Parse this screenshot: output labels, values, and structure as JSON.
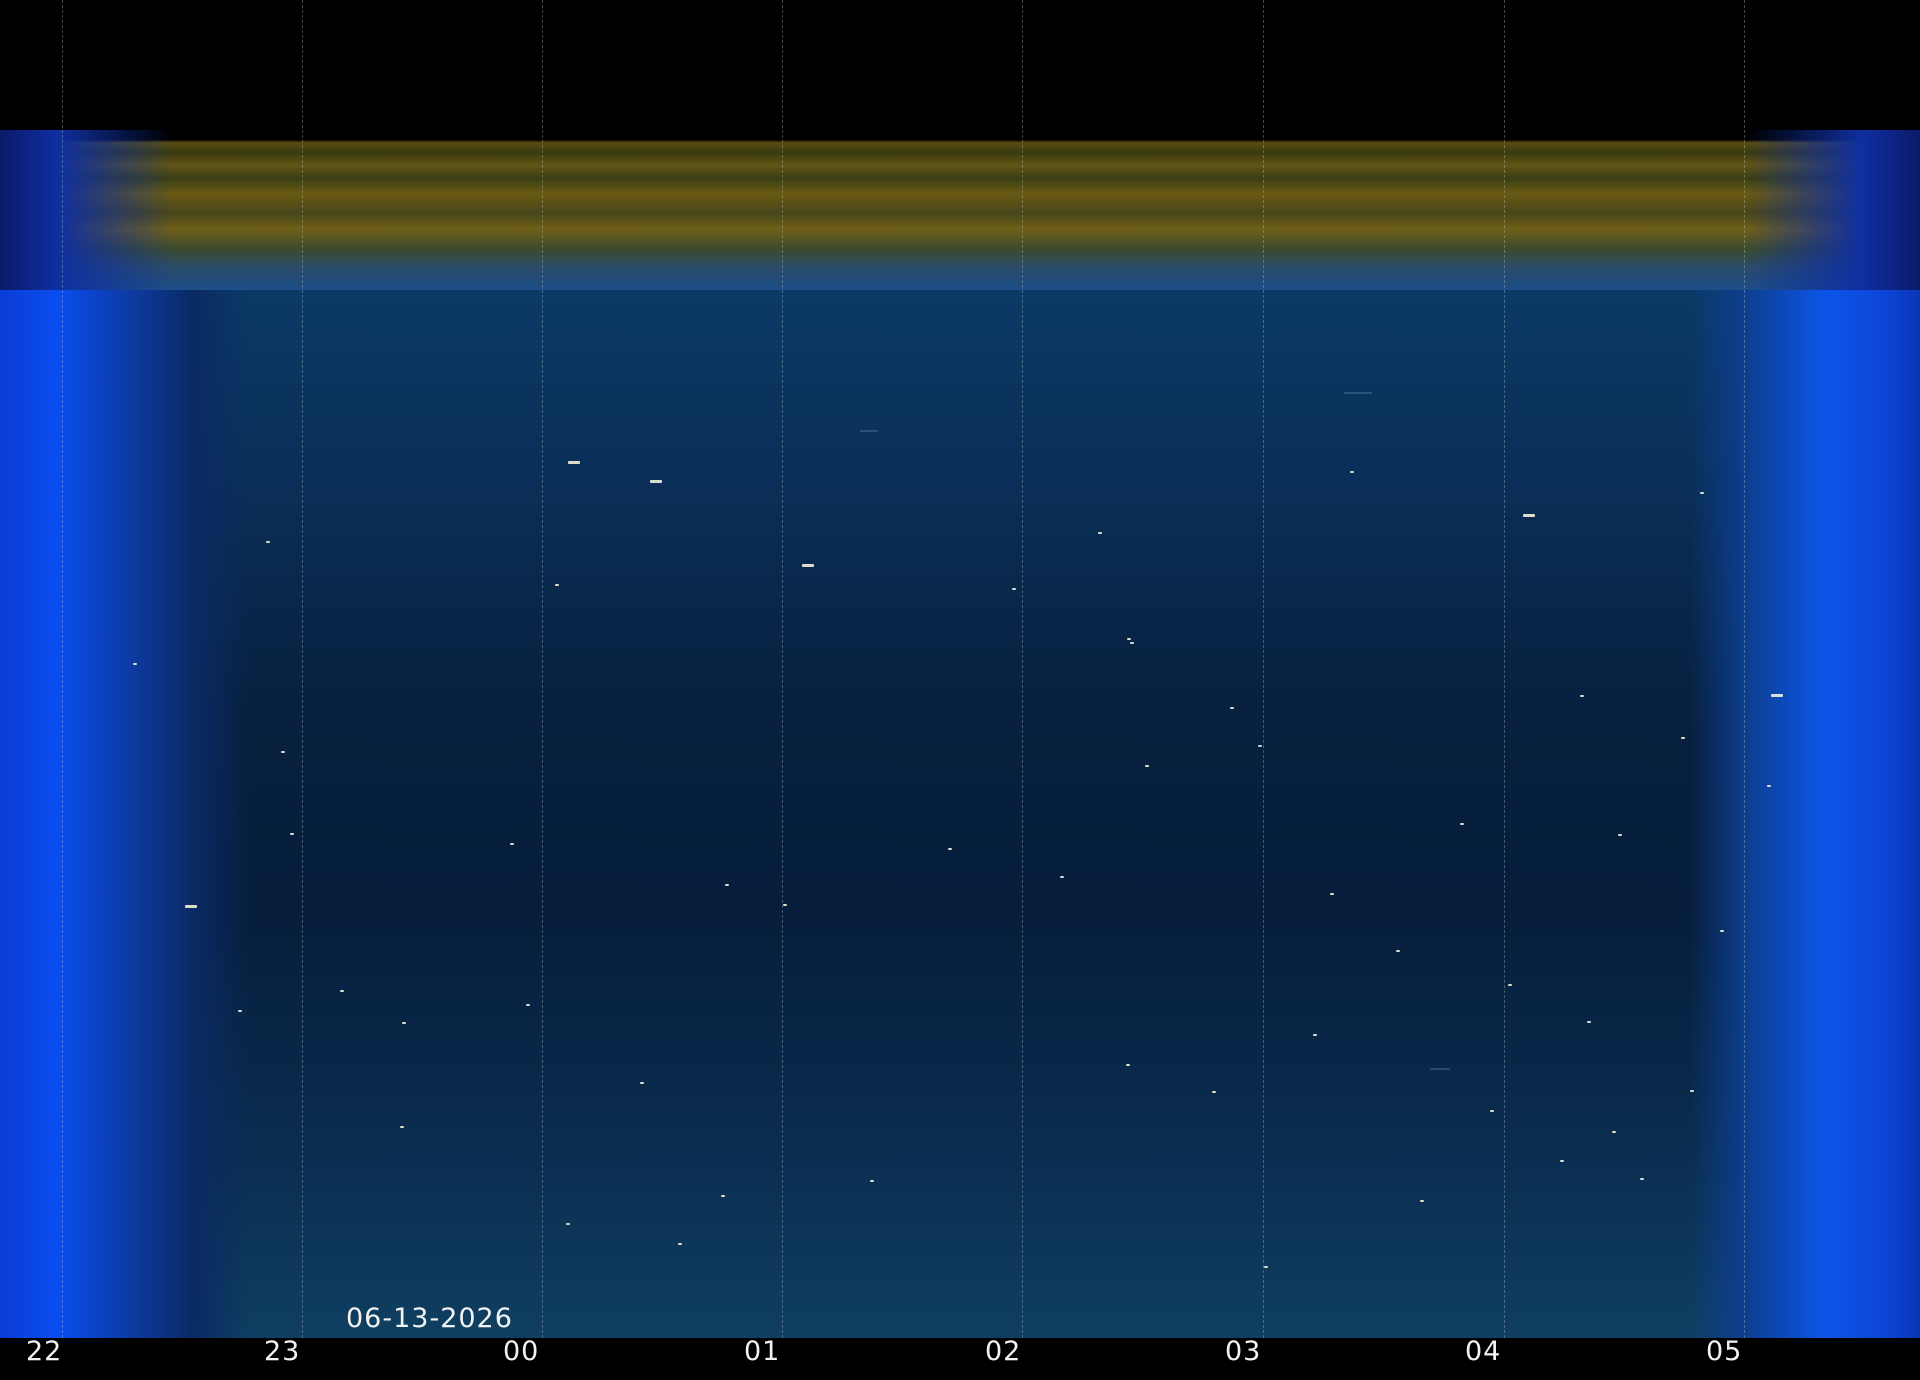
{
  "image": {
    "kind": "keogram",
    "date_label": "06-13-2026",
    "hour_labels": [
      "22",
      "23",
      "00",
      "01",
      "02",
      "03",
      "04",
      "05"
    ],
    "colors": {
      "twilight_blue": "#0a4df0",
      "night_sky": "#061e3c",
      "airglow_band": "#615516",
      "grid_line": "#c8c8c8",
      "label_text": "#f2f2f2"
    }
  }
}
